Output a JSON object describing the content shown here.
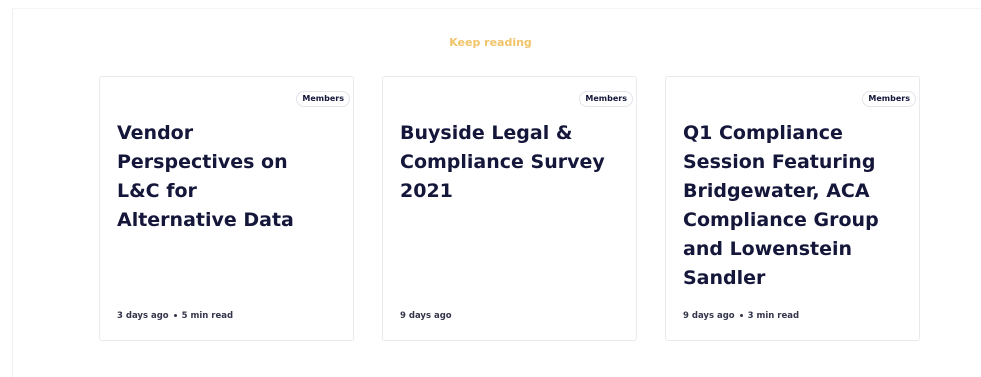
{
  "section": {
    "title": "Keep reading"
  },
  "cards": [
    {
      "badge": "Members",
      "title": "Vendor Perspectives on L&C for Alternative Data",
      "date": "3 days ago",
      "read_time": "5 min read"
    },
    {
      "badge": "Members",
      "title": "Buyside Legal & Compliance Survey 2021",
      "date": "9 days ago"
    },
    {
      "badge": "Members",
      "title": "Q1 Compliance Session Featuring Bridgewater, ACA Compliance Group and Lowenstein Sandler",
      "date": "9 days ago",
      "read_time": "3 min read"
    }
  ],
  "colors": {
    "accent": "#f2c46a",
    "title_text": "#14163a",
    "card_border": "#e9e9ee"
  }
}
